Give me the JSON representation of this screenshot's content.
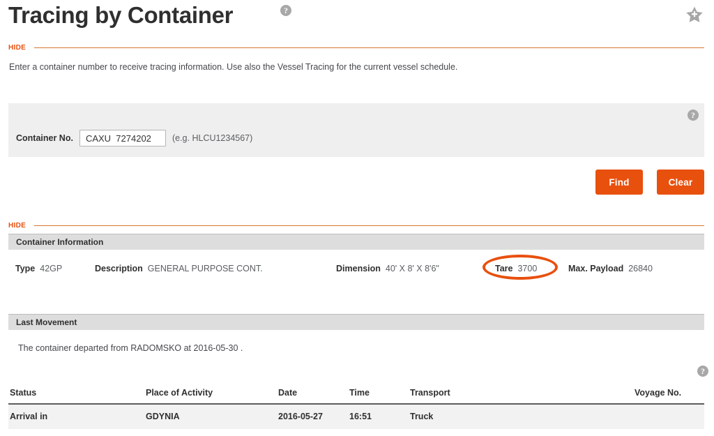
{
  "header": {
    "title": "Tracing by Container",
    "help_icon": "help-circle-icon",
    "favorite_icon": "star-add-icon"
  },
  "hide_links": {
    "top_label": "HIDE",
    "results_label": "HIDE"
  },
  "intro": {
    "text": "Enter a container number to receive tracing information. Use also the Vessel Tracing for the current vessel schedule."
  },
  "search_panel": {
    "help_icon": "help-circle-icon",
    "field_label": "Container No.",
    "field_value": "CAXU  7274202",
    "field_placeholder": "",
    "hint": "(e.g. HLCU1234567)"
  },
  "actions": {
    "find_label": "Find",
    "clear_label": "Clear"
  },
  "container_information": {
    "section_title": "Container Information",
    "type_label": "Type",
    "type_value": "42GP",
    "description_label": "Description",
    "description_value": "GENERAL PURPOSE CONT.",
    "dimension_label": "Dimension",
    "dimension_value": "40' X 8' X 8'6\"",
    "tare_label": "Tare",
    "tare_value": "3700",
    "payload_label": "Max. Payload",
    "payload_value": "26840"
  },
  "last_movement": {
    "section_title": "Last Movement",
    "text": "The container departed from RADOMSKO at 2016-05-30 ."
  },
  "events": {
    "help_icon": "help-circle-icon",
    "columns": [
      "Status",
      "Place of Activity",
      "Date",
      "Time",
      "Transport",
      "Voyage No."
    ],
    "rows": [
      {
        "status": "Arrival in",
        "place": "GDYNIA",
        "date": "2016-05-27",
        "time": "16:51",
        "transport": "Truck",
        "voyage": ""
      }
    ]
  },
  "colors": {
    "accent_orange": "#e8500e",
    "rule_orange": "#d9772f",
    "panel_gray": "#efefef",
    "section_gray": "#dddddd",
    "row_gray": "#f2f2f2",
    "text_dark": "#2f2f2f"
  }
}
